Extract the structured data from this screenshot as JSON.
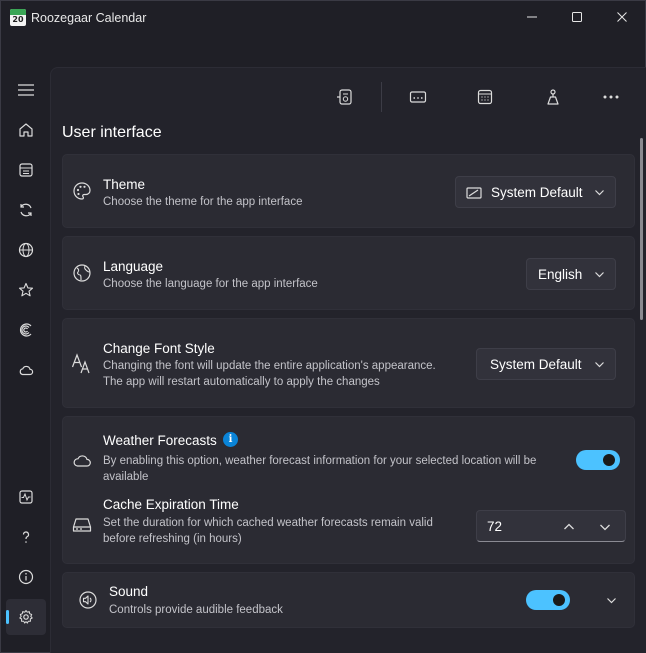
{
  "window": {
    "title": "Roozegaar Calendar",
    "icon_number": "20"
  },
  "section": {
    "title": "User interface"
  },
  "settings": {
    "theme": {
      "title": "Theme",
      "description": "Choose the theme for the app interface",
      "value": "System Default"
    },
    "language": {
      "title": "Language",
      "description": "Choose the language for the app interface",
      "value": "English"
    },
    "font": {
      "title": "Change Font Style",
      "description_line1": "Changing the font will update the entire application's appearance.",
      "description_line2": "The app will restart automatically to apply the changes",
      "value": "System Default"
    },
    "weather": {
      "title": "Weather Forecasts",
      "info_badge": "i",
      "description_line1": "By enabling this option, weather forecast information for your selected location will be",
      "description_line2": "available",
      "enabled": true
    },
    "cache": {
      "title": "Cache Expiration Time",
      "description_line1": "Set the duration for which cached weather forecasts remain valid",
      "description_line2": "before refreshing (in hours)",
      "value": "72"
    },
    "sound": {
      "title": "Sound",
      "description": "Controls provide audible feedback",
      "enabled": true
    }
  },
  "colors": {
    "accent": "#4cc2ff",
    "info": "#0a84d8"
  }
}
